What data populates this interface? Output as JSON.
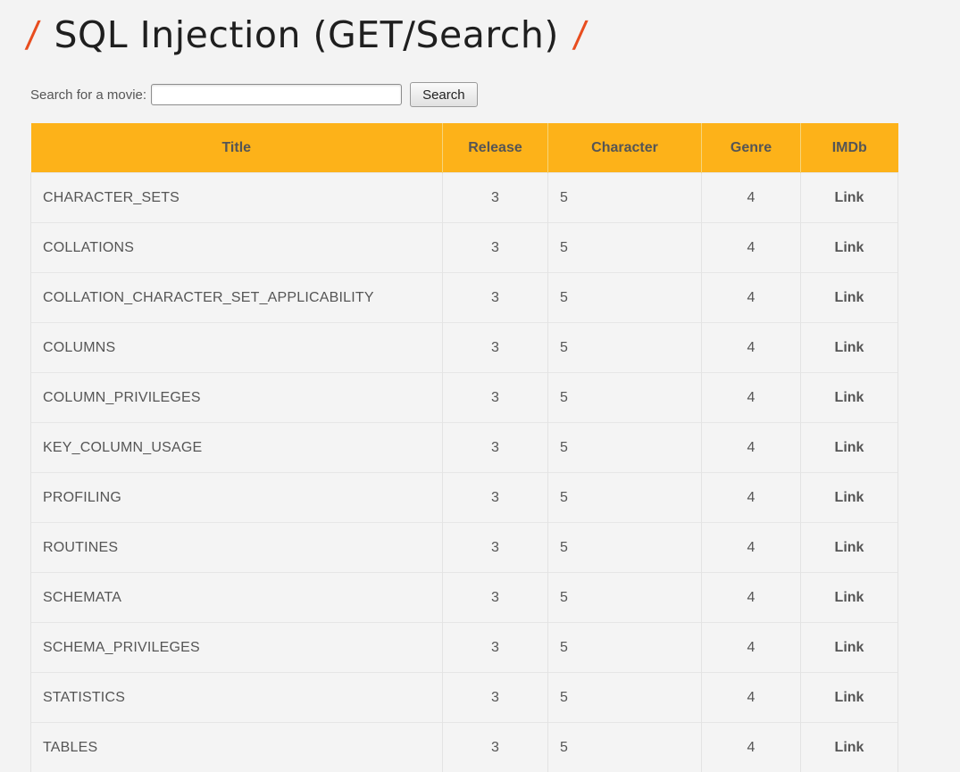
{
  "heading": {
    "slash_left": "/",
    "title": "SQL Injection (GET/Search)",
    "slash_right": "/",
    "accent_color": "#e84d1f"
  },
  "search": {
    "label": "Search for a movie:",
    "value": "",
    "placeholder": "",
    "button_label": "Search"
  },
  "table": {
    "header_color": "#fdb219",
    "columns": [
      "Title",
      "Release",
      "Character",
      "Genre",
      "IMDb"
    ],
    "rows": [
      {
        "title": "CHARACTER_SETS",
        "release": "3",
        "character": "5",
        "genre": "4",
        "imdb": "Link"
      },
      {
        "title": "COLLATIONS",
        "release": "3",
        "character": "5",
        "genre": "4",
        "imdb": "Link"
      },
      {
        "title": "COLLATION_CHARACTER_SET_APPLICABILITY",
        "release": "3",
        "character": "5",
        "genre": "4",
        "imdb": "Link"
      },
      {
        "title": "COLUMNS",
        "release": "3",
        "character": "5",
        "genre": "4",
        "imdb": "Link"
      },
      {
        "title": "COLUMN_PRIVILEGES",
        "release": "3",
        "character": "5",
        "genre": "4",
        "imdb": "Link"
      },
      {
        "title": "KEY_COLUMN_USAGE",
        "release": "3",
        "character": "5",
        "genre": "4",
        "imdb": "Link"
      },
      {
        "title": "PROFILING",
        "release": "3",
        "character": "5",
        "genre": "4",
        "imdb": "Link"
      },
      {
        "title": "ROUTINES",
        "release": "3",
        "character": "5",
        "genre": "4",
        "imdb": "Link"
      },
      {
        "title": "SCHEMATA",
        "release": "3",
        "character": "5",
        "genre": "4",
        "imdb": "Link"
      },
      {
        "title": "SCHEMA_PRIVILEGES",
        "release": "3",
        "character": "5",
        "genre": "4",
        "imdb": "Link"
      },
      {
        "title": "STATISTICS",
        "release": "3",
        "character": "5",
        "genre": "4",
        "imdb": "Link"
      },
      {
        "title": "TABLES",
        "release": "3",
        "character": "5",
        "genre": "4",
        "imdb": "Link"
      }
    ]
  }
}
